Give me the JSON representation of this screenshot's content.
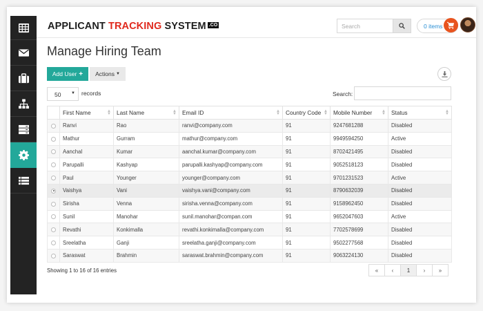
{
  "header": {
    "logo_part1": "APPLICANT ",
    "logo_part2": "TRACKING",
    "logo_part3": " SYSTEM",
    "logo_suffix": ".CO",
    "search_placeholder": "Search",
    "items_label": "0 items"
  },
  "sidebar": {
    "items": [
      {
        "name": "dashboard",
        "icon": "grid-icon",
        "active": false
      },
      {
        "name": "messages",
        "icon": "envelope-icon",
        "active": false
      },
      {
        "name": "jobs",
        "icon": "briefcase-icon",
        "active": false
      },
      {
        "name": "organization",
        "icon": "sitemap-icon",
        "active": false
      },
      {
        "name": "servers",
        "icon": "server-icon",
        "active": false
      },
      {
        "name": "settings",
        "icon": "gear-icon",
        "active": true
      },
      {
        "name": "list",
        "icon": "list-icon",
        "active": false
      }
    ]
  },
  "page": {
    "title": "Manage Hiring Team",
    "add_user_label": "Add User",
    "actions_label": "Actions",
    "page_length": "50",
    "records_label": "records",
    "search_label": "Search:"
  },
  "table": {
    "columns": [
      "",
      "First Name",
      "Last Name",
      "Email ID",
      "Country Code",
      "Mobile Number",
      "Status"
    ],
    "rows": [
      {
        "first": "Ranvi",
        "last": "Rao",
        "email": "ranvi@company.com",
        "code": "91",
        "mobile": "9247681288",
        "status": "Disabled",
        "selected": false
      },
      {
        "first": "Mathur",
        "last": "Gurram",
        "email": "mathur@company.com",
        "code": "91",
        "mobile": "9949594250",
        "status": "Active",
        "selected": false
      },
      {
        "first": "Aanchal",
        "last": "Kumar",
        "email": "aanchal.kumar@company.com",
        "code": "91",
        "mobile": "8702421495",
        "status": "Disabled",
        "selected": false
      },
      {
        "first": "Parupalli",
        "last": "Kashyap",
        "email": "parupalli.kashyap@company.com",
        "code": "91",
        "mobile": "9052518123",
        "status": "Disabled",
        "selected": false
      },
      {
        "first": "Paul",
        "last": "Younger",
        "email": "younger@company.com",
        "code": "91",
        "mobile": "9701231523",
        "status": "Active",
        "selected": false
      },
      {
        "first": "Vaishya",
        "last": "Vani",
        "email": "vaishya.vani@company.com",
        "code": "91",
        "mobile": "8790632039",
        "status": "Disabled",
        "selected": true
      },
      {
        "first": "Sirisha",
        "last": "Venna",
        "email": "sirisha.venna@company.com",
        "code": "91",
        "mobile": "9158962450",
        "status": "Disabled",
        "selected": false
      },
      {
        "first": "Sunil",
        "last": "Manohar",
        "email": "sunil.manohar@compan.com",
        "code": "91",
        "mobile": "9652047603",
        "status": "Active",
        "selected": false
      },
      {
        "first": "Revathi",
        "last": "Konkimalla",
        "email": "revathi.konkimalla@company.com",
        "code": "91",
        "mobile": "7702578699",
        "status": "Disabled",
        "selected": false
      },
      {
        "first": "Sreelatha",
        "last": "Ganji",
        "email": "sreelatha.ganji@company.com",
        "code": "91",
        "mobile": "9502277568",
        "status": "Disabled",
        "selected": false
      },
      {
        "first": "Saraswat",
        "last": "Brahmin",
        "email": "saraswat.brahmin@company.com",
        "code": "91",
        "mobile": "9063224130",
        "status": "Disabled",
        "selected": false
      }
    ]
  },
  "footer": {
    "showing_text": "Showing 1 to 16 of 16 entries",
    "pager": [
      "«",
      "‹",
      "1",
      "›",
      "»"
    ],
    "current_page": "1"
  },
  "colors": {
    "accent": "#23a89a",
    "brand_red": "#e0291d",
    "cart": "#e8541f",
    "sidebar_bg": "#232323"
  }
}
